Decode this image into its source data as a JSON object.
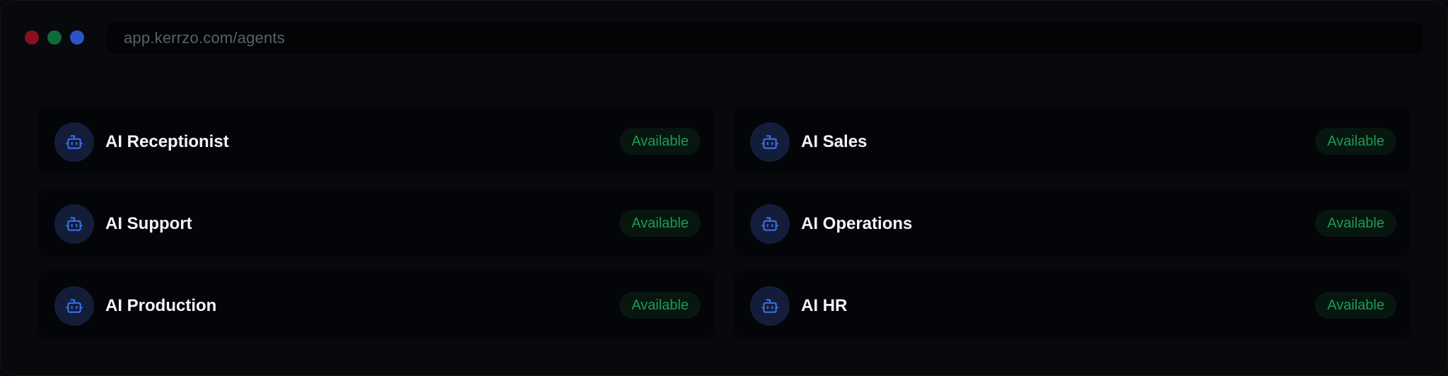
{
  "window": {
    "url": "app.kerrzo.com/agents"
  },
  "agents": [
    {
      "name": "AI Receptionist",
      "status": "Available",
      "icon": "robot-icon"
    },
    {
      "name": "AI Sales",
      "status": "Available",
      "icon": "robot-icon"
    },
    {
      "name": "AI Support",
      "status": "Available",
      "icon": "robot-icon"
    },
    {
      "name": "AI Operations",
      "status": "Available",
      "icon": "robot-icon"
    },
    {
      "name": "AI Production",
      "status": "Available",
      "icon": "robot-icon"
    },
    {
      "name": "AI HR",
      "status": "Available",
      "icon": "robot-icon"
    }
  ],
  "colors": {
    "accent": "#3b6fe0",
    "status_available": "#1e9a55",
    "background": "#07090d"
  }
}
